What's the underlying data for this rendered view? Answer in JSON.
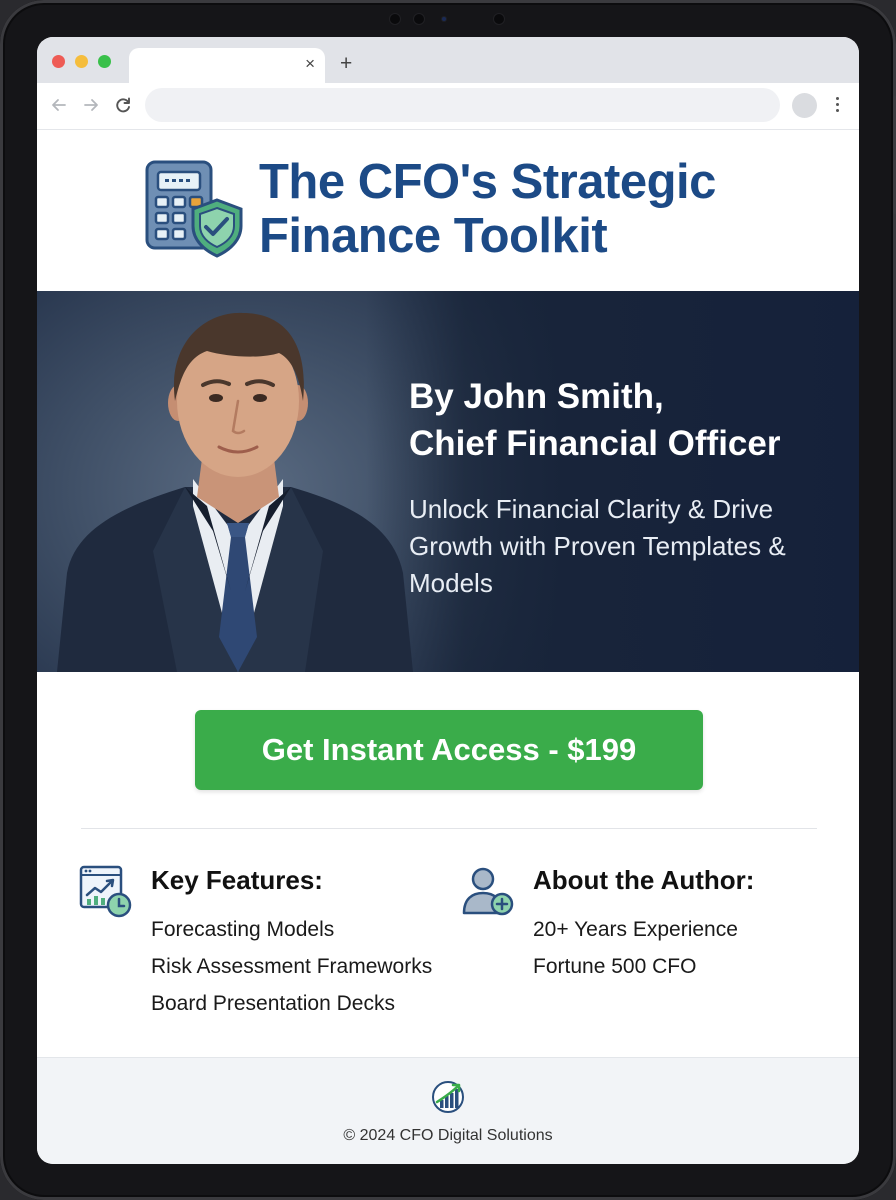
{
  "browser": {
    "tab_close_glyph": "×",
    "new_tab_glyph": "+",
    "address_value": "",
    "nav_icons": [
      "back-arrow-icon",
      "forward-arrow-icon",
      "reload-icon"
    ],
    "menu_icon": "kebab-menu-icon"
  },
  "header": {
    "logo_icon": "calculator-shield-icon",
    "title": "The CFO's Strategic Finance Toolkit"
  },
  "hero": {
    "portrait": "author-portrait",
    "byline_line1": "By John Smith,",
    "byline_line2": "Chief Financial Officer",
    "tagline": "Unlock Financial Clarity & Drive Growth with Proven Templates & Models"
  },
  "cta": {
    "label": "Get Instant Access - $199",
    "color": "#3aac4a"
  },
  "features": {
    "icon": "growth-chart-icon",
    "heading": "Key Features:",
    "items": [
      "Forecasting Models",
      "Risk Assessment Frameworks",
      "Board Presentation Decks"
    ]
  },
  "author": {
    "icon": "user-plus-icon",
    "heading": "About the Author:",
    "items": [
      "20+ Years Experience",
      "Fortune 500 CFO"
    ]
  },
  "footer": {
    "logo_icon": "growth-logo-icon",
    "copyright": "© 2024 CFO Digital Solutions"
  },
  "colors": {
    "title_blue": "#1c4a86",
    "hero_navy": "#18243a",
    "cta_green": "#3aac4a"
  }
}
